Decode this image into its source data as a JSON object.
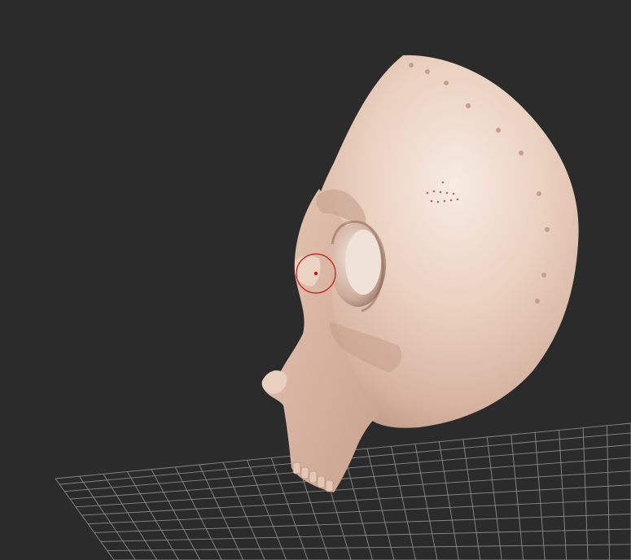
{
  "viewport": {
    "background": "#2b2b2b",
    "grid_color": "#9a9a9a",
    "model": {
      "name": "skull",
      "base_color": "#e8cbb8",
      "shadow_color": "#b58f7d",
      "highlight_color": "#f6e8df"
    },
    "brush_cursor": {
      "color": "#cc1111"
    }
  }
}
